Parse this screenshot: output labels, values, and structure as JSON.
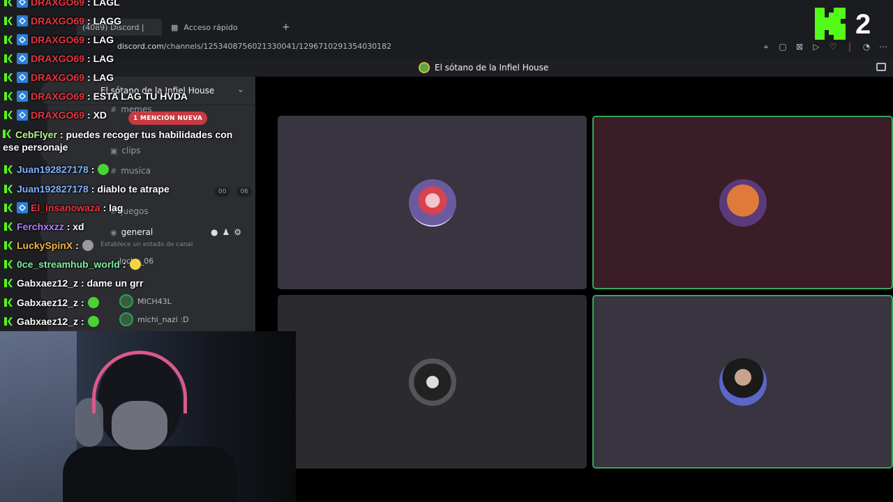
{
  "browser": {
    "active_tab": "(4089) Discord | ",
    "quick_access_tab": "Acceso rápido",
    "new_tab": "+",
    "url_host": "discord.com",
    "url_path": "/channels/1253408756021330041/1296710291354030182"
  },
  "discord": {
    "server_title": "El sótano de la Infiel House",
    "sidebar_server_name": "El sótano de la Infiel House",
    "mention_pill": "1 MENCIÓN NUEVA",
    "channels": [
      {
        "name": "memes"
      },
      {
        "name": "clips"
      },
      {
        "name": "musica"
      },
      {
        "name": "juegos"
      },
      {
        "name": "general"
      }
    ],
    "timer": [
      "00",
      "06"
    ],
    "status_prompt": "Establece un estado de canal",
    "voice_users": [
      "MICH43L",
      "michi_nazi :D"
    ],
    "partial_voice_users": [
      "Jocho_06"
    ]
  },
  "stream": {
    "viewer_count": "2",
    "chat": [
      {
        "user": "DRAXGO69",
        "text": ": LAGL",
        "sub": true,
        "color": "#e8333f"
      },
      {
        "user": "DRAXGO69",
        "text": ": LAGG",
        "sub": true,
        "color": "#e8333f"
      },
      {
        "user": "DRAXGO69",
        "text": ": LAG",
        "sub": true,
        "color": "#e8333f"
      },
      {
        "user": "DRAXGO69",
        "text": ": LAG",
        "sub": true,
        "color": "#e8333f"
      },
      {
        "user": "DRAXGO69",
        "text": ": LAG",
        "sub": true,
        "color": "#e8333f"
      },
      {
        "user": "DRAXGO69",
        "text": ": ESTA LAG TU HVDA",
        "sub": true,
        "color": "#e8333f"
      },
      {
        "user": "DRAXGO69",
        "text": ": XD",
        "sub": true,
        "color": "#e8333f"
      },
      {
        "user": "CebFlyer",
        "text": ": puedes recoger tus habilidades con ese personaje",
        "sub": false,
        "color": "#b6f58c"
      },
      {
        "user": "Juan192827178",
        "text": ":",
        "sub": false,
        "color": "#7fb2ff",
        "emote": "green"
      },
      {
        "user": "Juan192827178",
        "text": ": diablo te atrape",
        "sub": false,
        "color": "#7fb2ff"
      },
      {
        "user": "El_insanowaza",
        "text": ": lag",
        "sub": true,
        "color": "#e8333f"
      },
      {
        "user": "Ferchxxzz",
        "text": ": xd",
        "sub": false,
        "color": "#b57bff"
      },
      {
        "user": "LuckySpinX",
        "text": ":",
        "sub": false,
        "color": "#f2b34a",
        "emote": "grey"
      },
      {
        "user": "0ce_streamhub_world",
        "text": ":",
        "sub": false,
        "color": "#7ff0a0",
        "emote": "yellow"
      },
      {
        "user": "Gabxaez12_z",
        "text": ": dame un grr",
        "sub": false,
        "color": "#ffffff"
      },
      {
        "user": "Gabxaez12_z",
        "text": ":",
        "sub": false,
        "color": "#ffffff",
        "emote": "green"
      },
      {
        "user": "Gabxaez12_z",
        "text": ":",
        "sub": false,
        "color": "#ffffff",
        "emote": "green"
      }
    ]
  },
  "colors": {
    "kick_green": "#53fc18",
    "speaking_border": "#3ba55c",
    "mention_red": "#c73a3f"
  }
}
